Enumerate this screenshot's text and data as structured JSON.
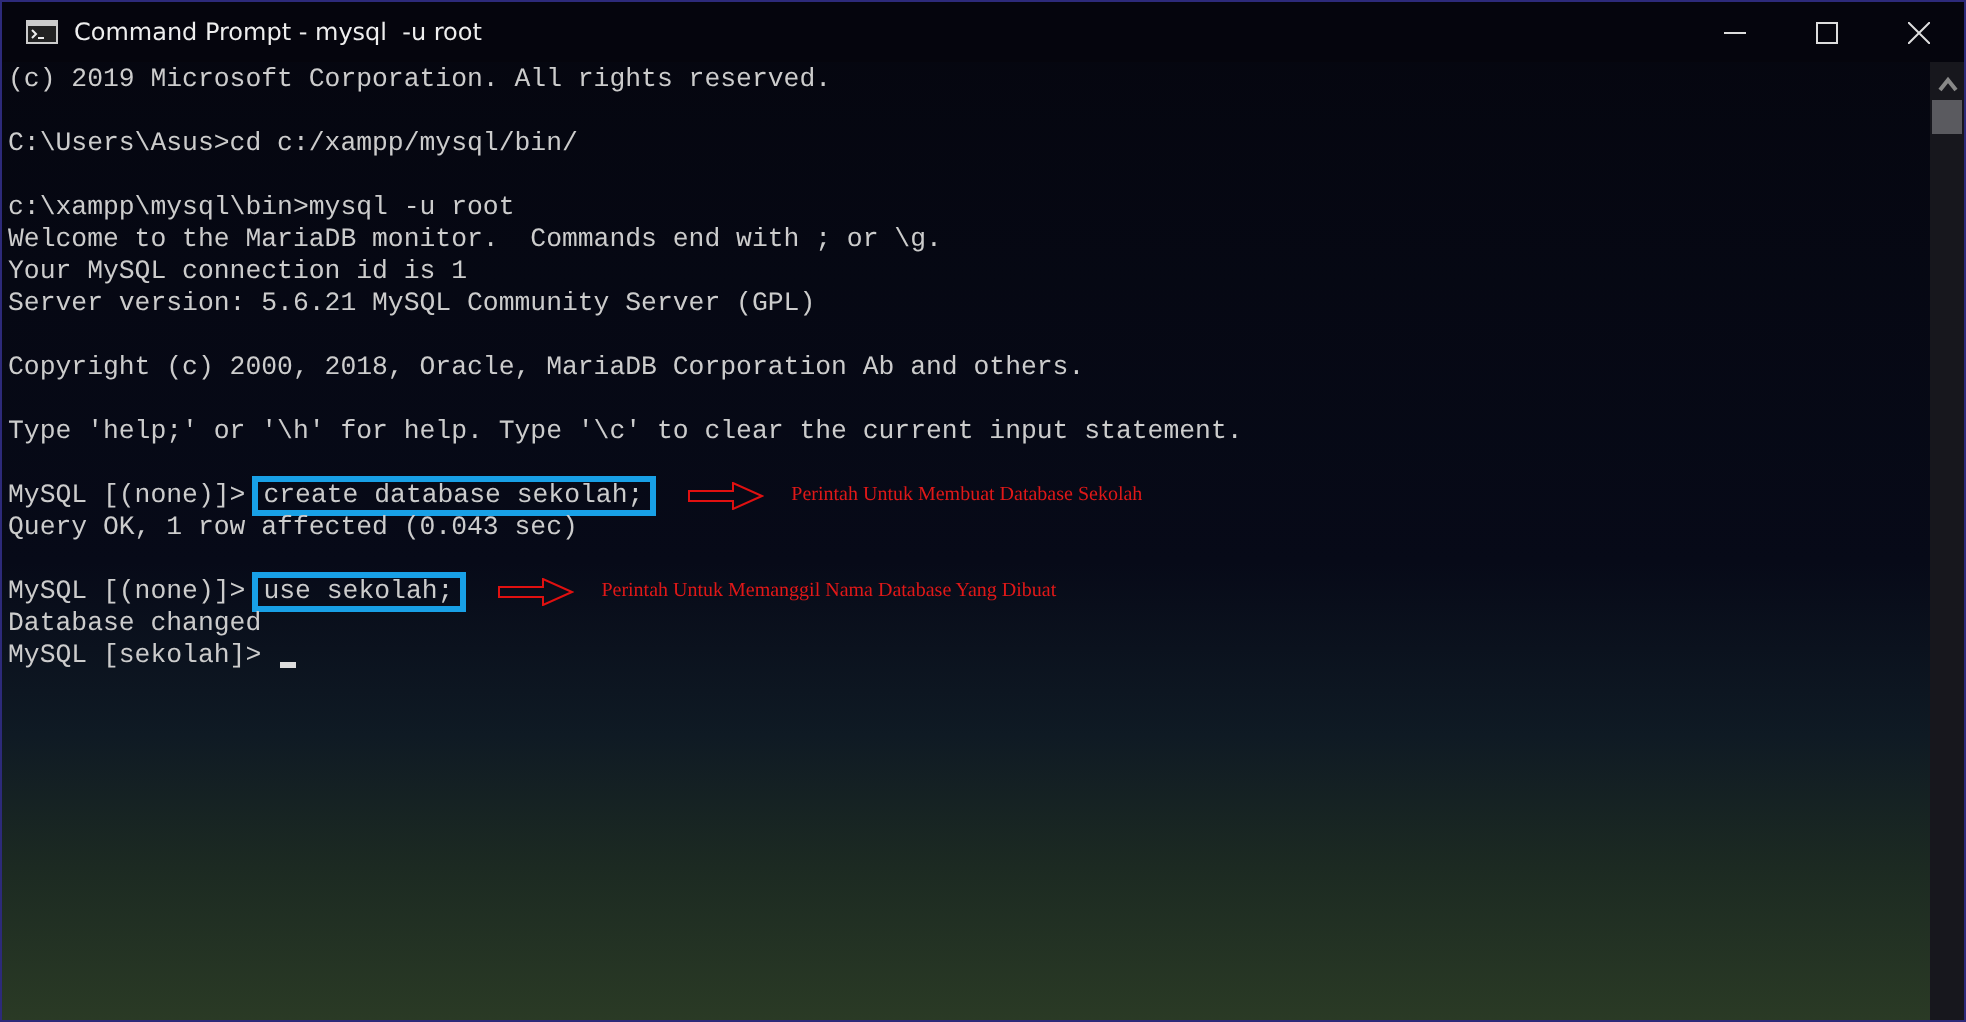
{
  "window": {
    "title": "Command Prompt - mysql  -u root"
  },
  "lines": [
    {
      "kind": "text",
      "text": "(c) 2019 Microsoft Corporation. All rights reserved."
    },
    {
      "kind": "blank"
    },
    {
      "kind": "text",
      "text": "C:\\Users\\Asus>cd c:/xampp/mysql/bin/"
    },
    {
      "kind": "blank"
    },
    {
      "kind": "text",
      "text": "c:\\xampp\\mysql\\bin>mysql -u root"
    },
    {
      "kind": "text",
      "text": "Welcome to the MariaDB monitor.  Commands end with ; or \\g."
    },
    {
      "kind": "text",
      "text": "Your MySQL connection id is 1"
    },
    {
      "kind": "text",
      "text": "Server version: 5.6.21 MySQL Community Server (GPL)"
    },
    {
      "kind": "blank"
    },
    {
      "kind": "text",
      "text": "Copyright (c) 2000, 2018, Oracle, MariaDB Corporation Ab and others."
    },
    {
      "kind": "blank"
    },
    {
      "kind": "text",
      "text": "Type 'help;' or '\\h' for help. Type '\\c' to clear the current input statement."
    },
    {
      "kind": "blank"
    },
    {
      "kind": "command",
      "prompt": "MySQL [(none)]>",
      "command": "create database sekolah;",
      "note": "Perintah Untuk Membuat Database Sekolah"
    },
    {
      "kind": "text",
      "text": "Query OK, 1 row affected (0.043 sec)"
    },
    {
      "kind": "blank"
    },
    {
      "kind": "command",
      "prompt": "MySQL [(none)]>",
      "command": "use sekolah;",
      "note": "Perintah Untuk Memanggil Nama Database Yang Dibuat"
    },
    {
      "kind": "text",
      "text": "Database changed"
    },
    {
      "kind": "cursor",
      "prompt": "MySQL [sekolah]>"
    }
  ]
}
